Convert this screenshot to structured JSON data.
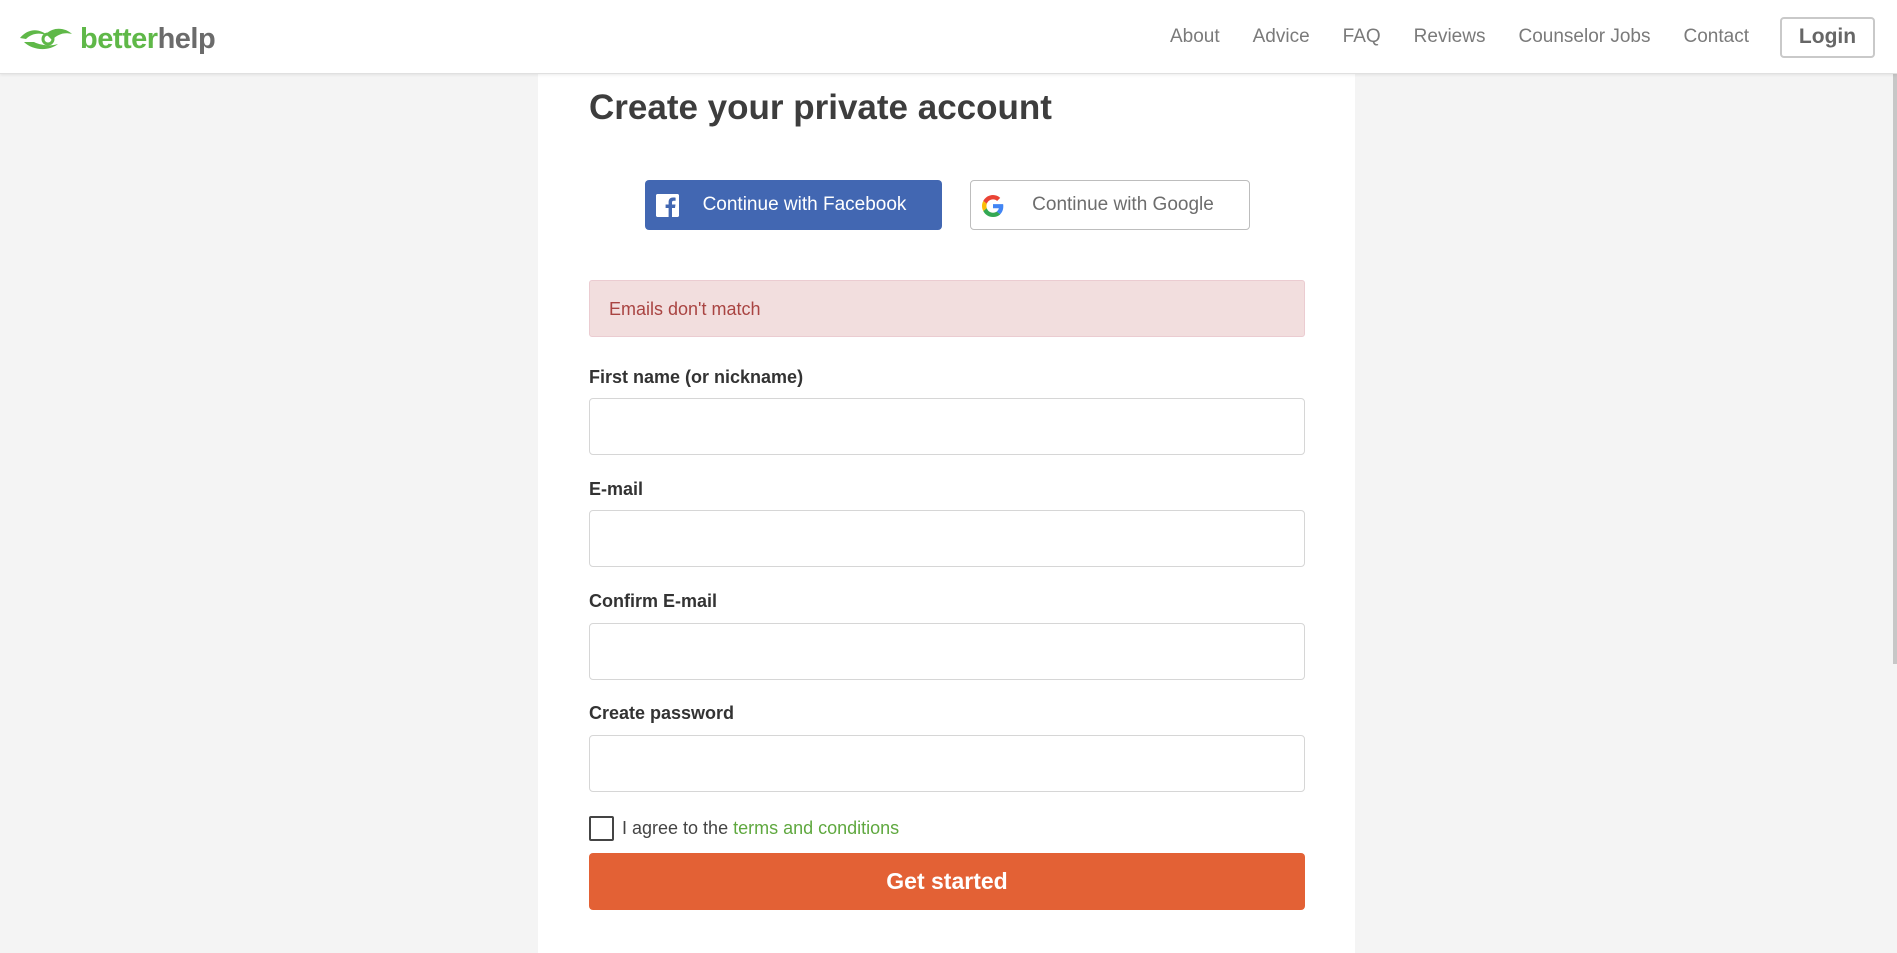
{
  "header": {
    "logo": {
      "better": "better",
      "help": "help",
      "icon": "leaf-hands-icon"
    },
    "nav": [
      "About",
      "Advice",
      "FAQ",
      "Reviews",
      "Counselor Jobs",
      "Contact"
    ],
    "login_label": "Login"
  },
  "form": {
    "title": "Create your private account",
    "facebook_label": "Continue with Facebook",
    "google_label": "Continue with Google",
    "error": "Emails don't match",
    "fields": [
      {
        "label": "First name (or nickname)",
        "value": ""
      },
      {
        "label": "E-mail",
        "value": ""
      },
      {
        "label": "Confirm E-mail",
        "value": ""
      },
      {
        "label": "Create password",
        "value": ""
      }
    ],
    "agree_prefix": "I agree to the",
    "terms_link": "terms and conditions",
    "submit_label": "Get started"
  },
  "colors": {
    "brand_green": "#5fb848",
    "facebook_blue": "#4267b2",
    "cta_orange": "#e36135",
    "error_bg": "#f2dede",
    "error_text": "#a94442"
  }
}
